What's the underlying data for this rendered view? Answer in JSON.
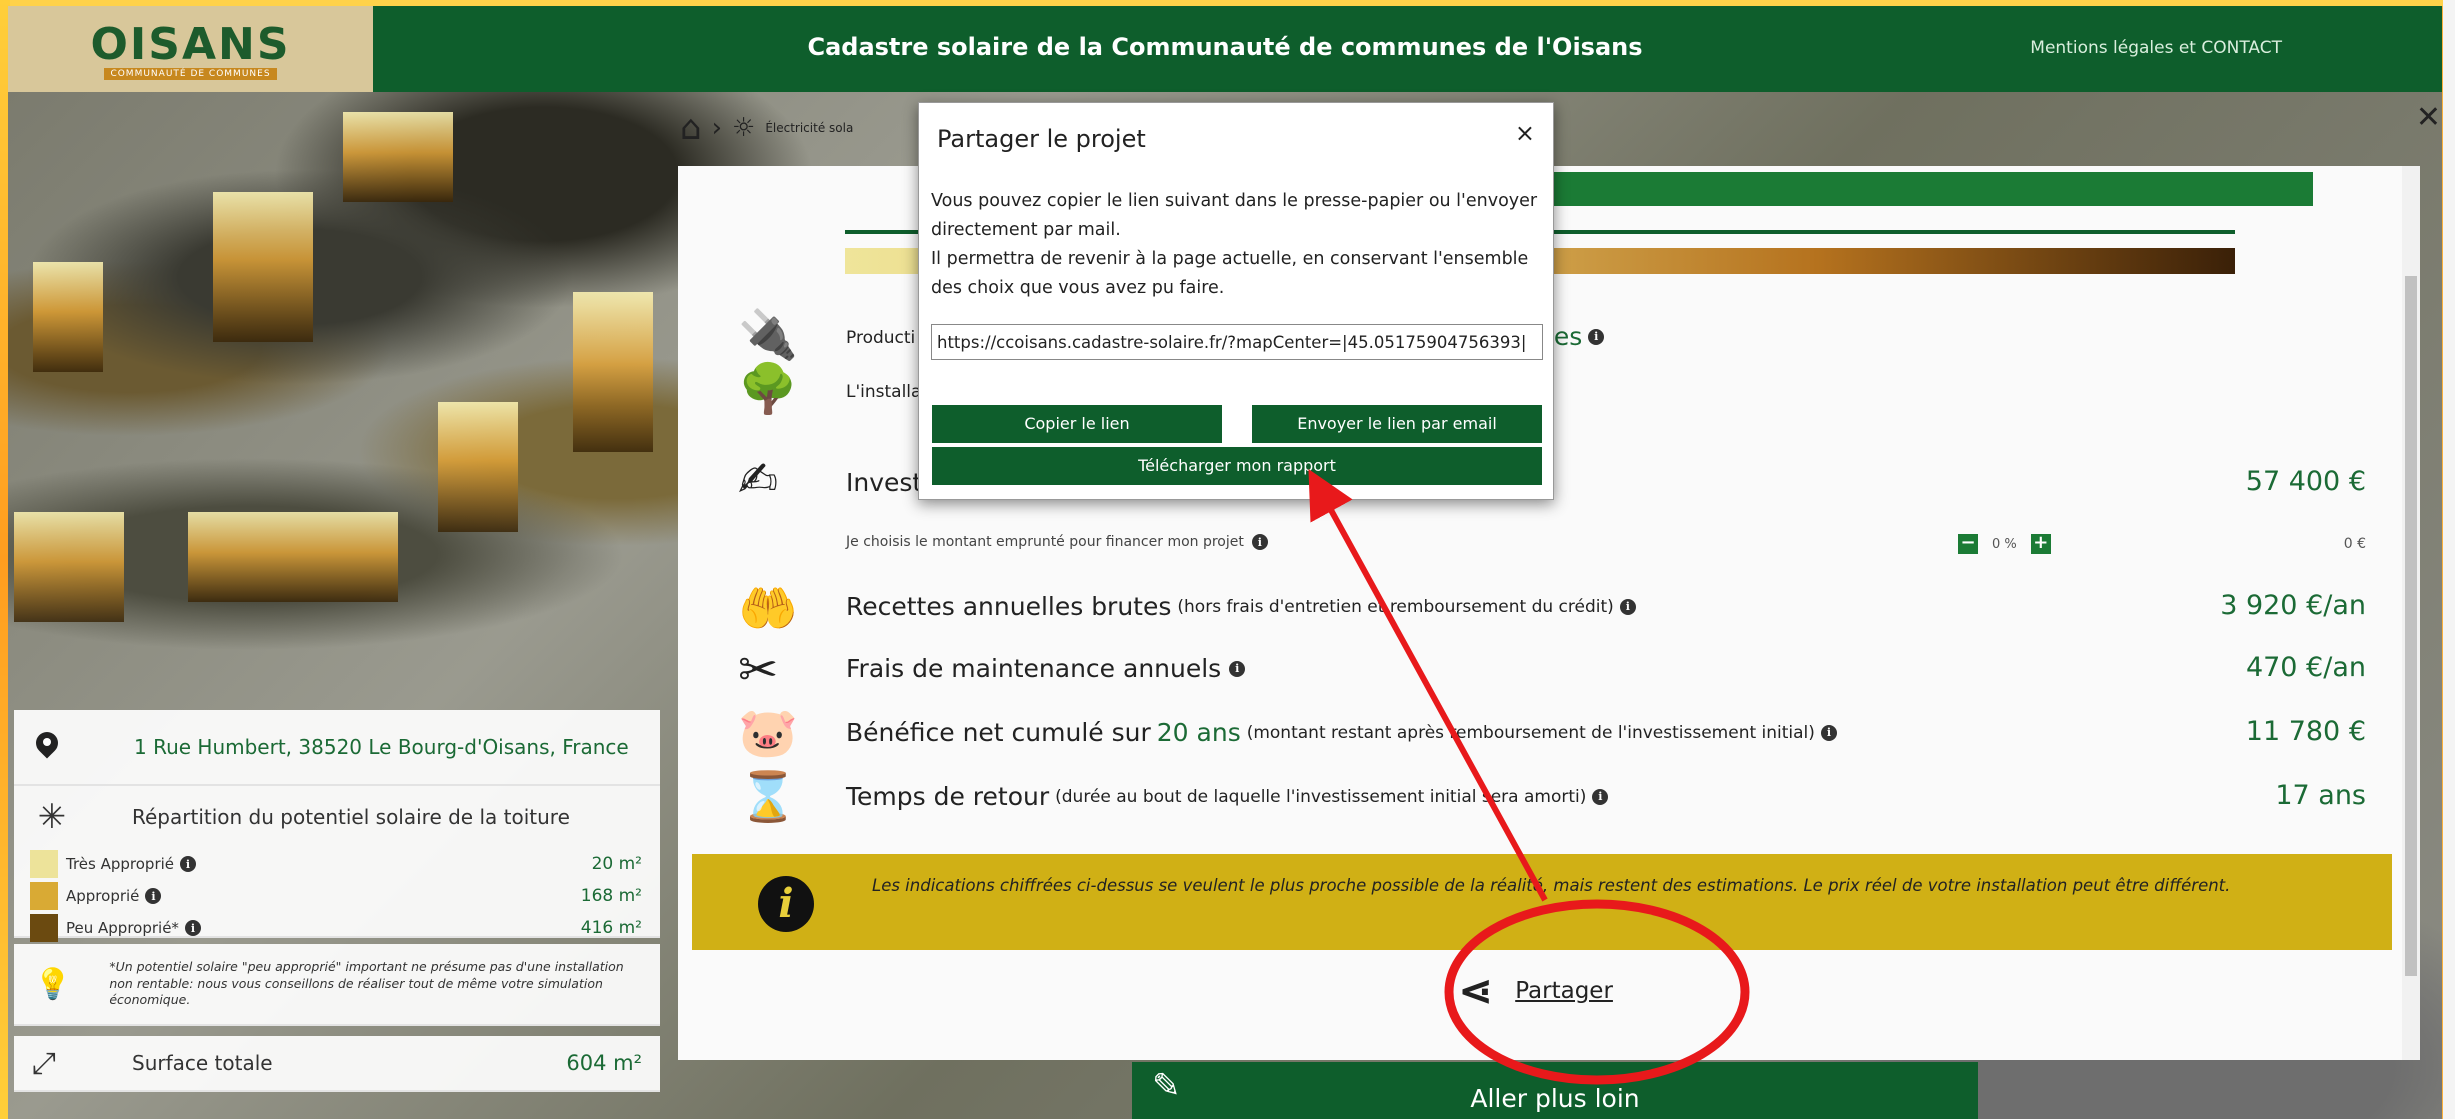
{
  "header": {
    "logo_text": "OISANS",
    "logo_sub": "COMMUNAUTÉ DE COMMUNES",
    "title": "Cadastre solaire de la Communauté de communes de l'Oisans",
    "legal_link": "Mentions légales et CONTACT"
  },
  "breadcrumb": {
    "text": "Électricité sola"
  },
  "info_panel": {
    "address": "1 Rue Humbert, 38520 Le Bourg-d'Oisans, France",
    "repartition_title": "Répartition du potentiel solaire de la toiture",
    "categories": [
      {
        "label": "Très Approprié",
        "value": "20 m²",
        "color": "#ede39a"
      },
      {
        "label": "Approprié",
        "value": "168 m²",
        "color": "#d9aa34"
      },
      {
        "label": "Peu Approprié*",
        "value": "416 m²",
        "color": "#6b4a10"
      }
    ],
    "note": "*Un potentiel solaire \"peu approprié\" important ne présume pas d'une installation non rentable: nous vous conseillons de réaliser tout de même votre simulation économique.",
    "surface_label": "Surface totale",
    "surface_value": "604 m²"
  },
  "content": {
    "production_label": "Producti",
    "production_suffix": "nes",
    "install_label": "L'installa",
    "invest_label": "Investi",
    "invest_value": "57 400 €",
    "loan_label": "Je choisis le montant emprunté pour financer mon projet",
    "loan_percent": "0 %",
    "loan_value": "0 €",
    "recettes_label": "Recettes annuelles brutes",
    "recettes_note": "(hors frais d'entretien et remboursement du crédit)",
    "recettes_value": "3 920 €/an",
    "maintenance_label": "Frais de maintenance annuels",
    "maintenance_value": "470 €/an",
    "benefice_label": "Bénéfice net cumulé sur",
    "benefice_years": "20 ans",
    "benefice_note": "(montant restant après remboursement de l'investissement initial)",
    "benefice_value": "11 780 €",
    "retour_label": "Temps de retour",
    "retour_note": "(durée au bout de laquelle l'investissement initial sera amorti)",
    "retour_value": "17 ans",
    "disclaimer": "Les indications chiffrées ci-dessus se veulent le plus proche possible de la réalité, mais restent des estimations. Le prix réel de votre installation peut être différent.",
    "share_label": "Partager",
    "aller_label": "Aller plus loin"
  },
  "modal": {
    "title": "Partager le projet",
    "close": "×",
    "body_line1": "Vous pouvez copier le lien suivant dans le presse-papier ou l'envoyer directement par mail.",
    "body_line2": "Il permettra de revenir à la page actuelle, en conservant l'ensemble des choix que vous avez pu faire.",
    "link_value": "https://ccoisans.cadastre-solaire.fr/?mapCenter=|45.05175904756393|",
    "copy_button": "Copier le lien",
    "email_button": "Envoyer le lien par email",
    "download_button": "Télécharger mon rapport"
  },
  "colors": {
    "brand_green": "#0e5e2c",
    "value_green": "#1b6a35",
    "disclaimer_yellow": "#d0b015",
    "annotation_red": "#e8191b"
  }
}
